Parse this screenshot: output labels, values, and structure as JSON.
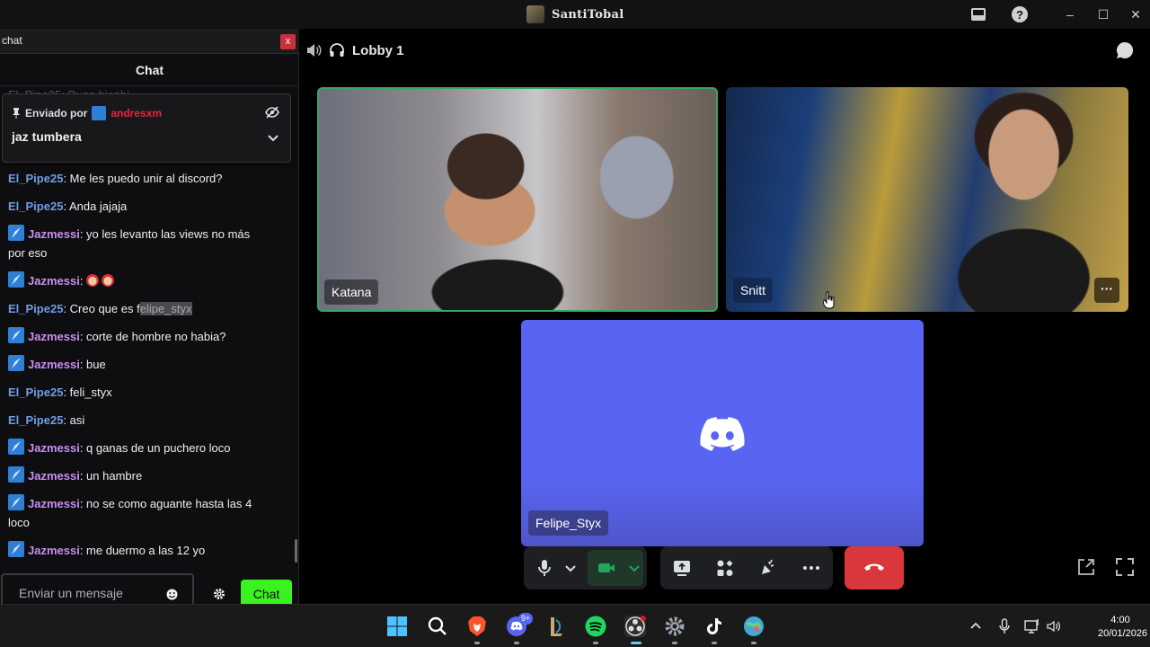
{
  "window": {
    "title": "SantiTobal",
    "icons": [
      "inbox-icon",
      "help-icon",
      "minimize-icon",
      "maximize-icon",
      "close-icon"
    ]
  },
  "chat": {
    "window_label": "chat",
    "close_label": "x",
    "header": "Chat",
    "ghost_line": "El_Pipe25: Duas bienbi...",
    "pinned": {
      "sent_by_label": "Enviado por",
      "sender": "andresxm",
      "message": "jaz tumbera"
    },
    "messages": [
      {
        "user": "El_Pipe25",
        "badge": false,
        "text": ": Me les puedo unir al discord?"
      },
      {
        "user": "El_Pipe25",
        "badge": false,
        "text": ": Anda jajaja"
      },
      {
        "user": "Jazmessi",
        "badge": true,
        "text": ": yo les levanto las views no más por eso"
      },
      {
        "user": "Jazmessi",
        "badge": true,
        "text": ": ",
        "emotes": 2
      },
      {
        "user": "El_Pipe25",
        "badge": false,
        "text": ": Creo que es f",
        "highlight": "elipe_styx"
      },
      {
        "user": "Jazmessi",
        "badge": true,
        "text": ": corte de hombre no habia?"
      },
      {
        "user": "Jazmessi",
        "badge": true,
        "text": ": bue"
      },
      {
        "user": "El_Pipe25",
        "badge": false,
        "text": ": feli_styx"
      },
      {
        "user": "El_Pipe25",
        "badge": false,
        "text": ": asi"
      },
      {
        "user": "Jazmessi",
        "badge": true,
        "text": ": q ganas de un puchero loco"
      },
      {
        "user": "Jazmessi",
        "badge": true,
        "text": ": un hambre"
      },
      {
        "user": "Jazmessi",
        "badge": true,
        "text": ": no se como aguante hasta las 4 loco"
      },
      {
        "user": "Jazmessi",
        "badge": true,
        "text": ": me duermo a las 12 yo"
      }
    ],
    "input_placeholder": "Enviar un mensaje",
    "send_label": "Chat",
    "colors": {
      "pipe": "#6f9de6",
      "jaz": "#c88ef0",
      "send": "#39f21f",
      "pinned_sender": "#e8243e"
    }
  },
  "voice": {
    "channel": "Lobby 1",
    "participants": [
      {
        "name": "Katana",
        "speaking": true
      },
      {
        "name": "Snitt",
        "speaking": false
      },
      {
        "name": "Felipe_Styx",
        "speaking": false,
        "camera": false
      }
    ],
    "colors": {
      "speaking_border": "#3ba55d",
      "avatar_bg": "#5865f2",
      "hangup": "#da373c"
    }
  },
  "taskbar": {
    "apps": [
      "windows-start-icon",
      "search-icon",
      "brave-icon",
      "discord-icon",
      "league-icon",
      "spotify-icon",
      "obs-icon",
      "settings-icon",
      "tiktok-icon",
      "browser-icon"
    ],
    "discord_badge": "9+",
    "time": "4:00",
    "date": "20/01/2026"
  }
}
